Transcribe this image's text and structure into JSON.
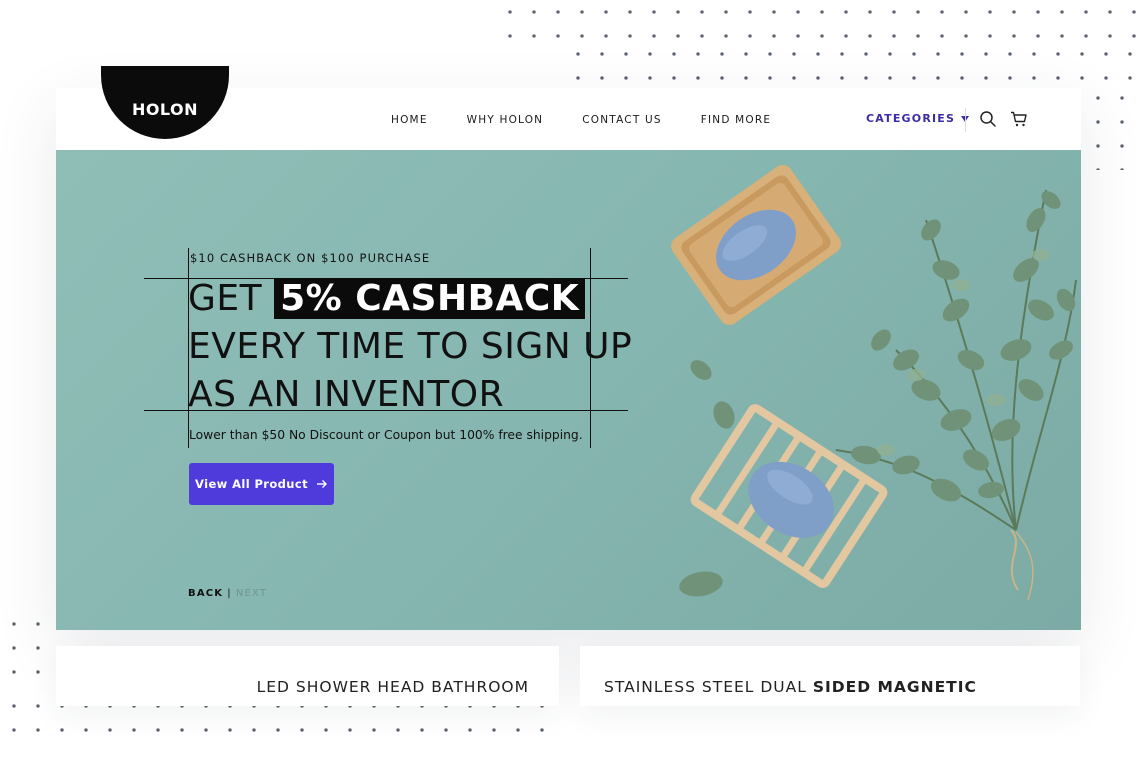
{
  "brand": {
    "logo_text": "HOLON"
  },
  "nav": {
    "items": [
      {
        "label": "HOME"
      },
      {
        "label": "WHY HOLON"
      },
      {
        "label": "CONTACT US"
      },
      {
        "label": "FIND MORE"
      }
    ],
    "categories_label": "CATEGORIES"
  },
  "icons": {
    "search": "search-icon",
    "cart": "cart-icon",
    "caret": "caret-down-icon",
    "arrow": "arrow-right-icon"
  },
  "hero": {
    "eyebrow": "$10 CASHBACK ON $100 PURCHASE",
    "headline_prefix": "GET",
    "headline_highlight": "5% CASHBACK",
    "headline_line2": "EVERY TIME TO SIGN UP",
    "headline_line3": "AS AN INVENTOR",
    "subline": "Lower than $50 No Discount or Coupon but 100% free shipping.",
    "cta_label": "View All Product",
    "pager_back": "BACK",
    "pager_sep": "|",
    "pager_next": "NEXT"
  },
  "products": [
    {
      "title": "LED SHOWER HEAD BATHROOM"
    },
    {
      "title_regular": "STAINLESS STEEL DUAL ",
      "title_bold": "SIDED MAGNETIC"
    }
  ],
  "colors": {
    "accent": "#4f3bdb",
    "categories": "#3a2ea6",
    "hero_bg": "#86b6b0",
    "soap": "#7f9fc9"
  }
}
